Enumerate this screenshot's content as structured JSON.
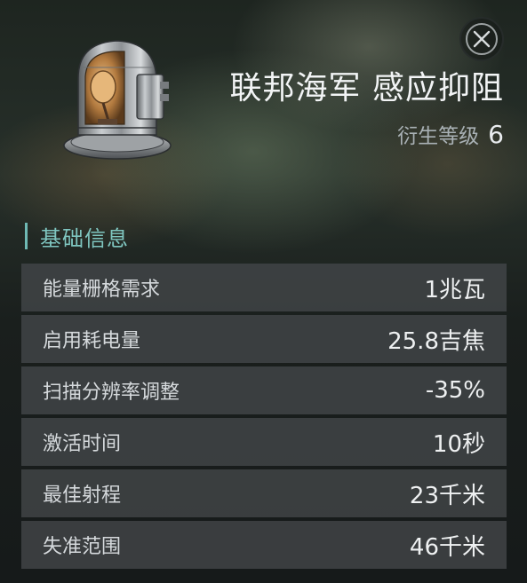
{
  "module": {
    "name": "联邦海军 感应抑阻",
    "meta_level_label": "衍生等级",
    "meta_level_value": "6",
    "icon": "sensor-dampener-dome-icon"
  },
  "close_icon": "close-icon",
  "section": {
    "title": "基础信息"
  },
  "attributes": [
    {
      "label": "能量栅格需求",
      "value": "1兆瓦"
    },
    {
      "label": "启用耗电量",
      "value": "25.8吉焦"
    },
    {
      "label": "扫描分辨率调整",
      "value": "-35%"
    },
    {
      "label": "激活时间",
      "value": "10秒"
    },
    {
      "label": "最佳射程",
      "value": "23千米"
    },
    {
      "label": "失准范围",
      "value": "46千米"
    }
  ],
  "colors": {
    "accent": "#6fb9b4",
    "row_bg": "#424648",
    "text": "#e9ecef"
  }
}
